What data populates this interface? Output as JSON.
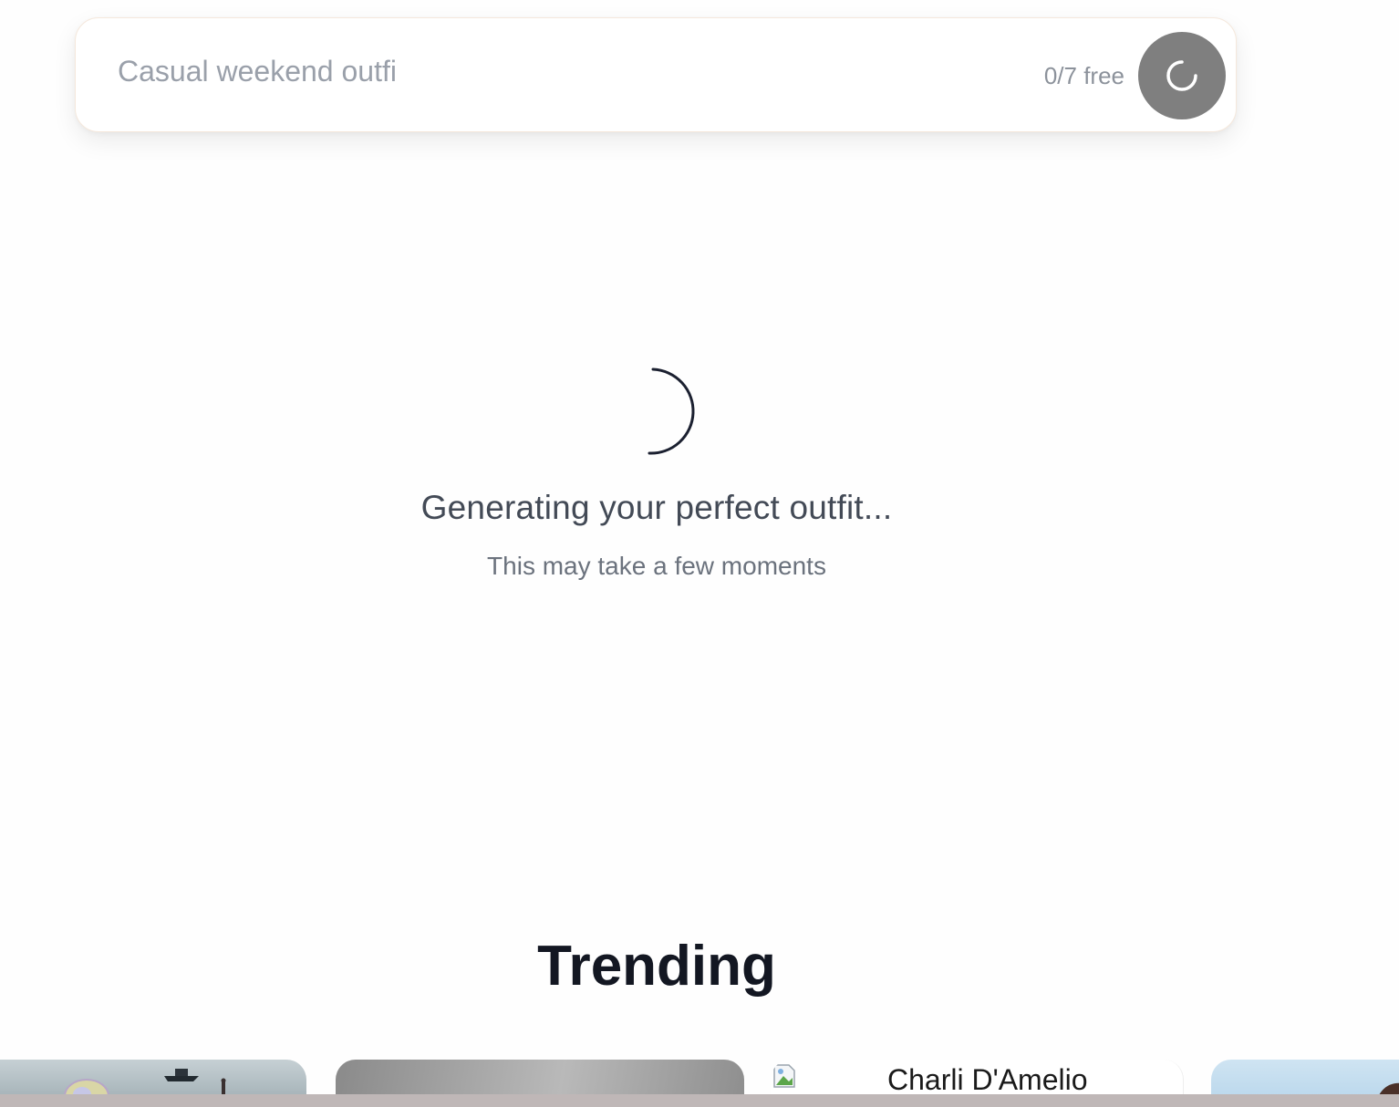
{
  "search": {
    "placeholder": "Casual weekend outfi",
    "value": "",
    "free_counter": "0/7 free",
    "submit_icon": "spinner-icon"
  },
  "loading": {
    "title": "Generating your perfect outfit...",
    "subtitle": "This may take a few moments",
    "icon": "loading-spinner-icon"
  },
  "trending": {
    "heading": "Trending",
    "cards": [
      {
        "name": "",
        "image": "beach-scene"
      },
      {
        "name": "",
        "image": "gray-gradient"
      },
      {
        "name": "Charli D'Amelio",
        "image": "broken-image"
      },
      {
        "name": "",
        "image": "sky-portrait"
      }
    ]
  },
  "colors": {
    "submit_button": "#7f7f7f",
    "title_text": "#434a56",
    "heading_text": "#131722"
  }
}
